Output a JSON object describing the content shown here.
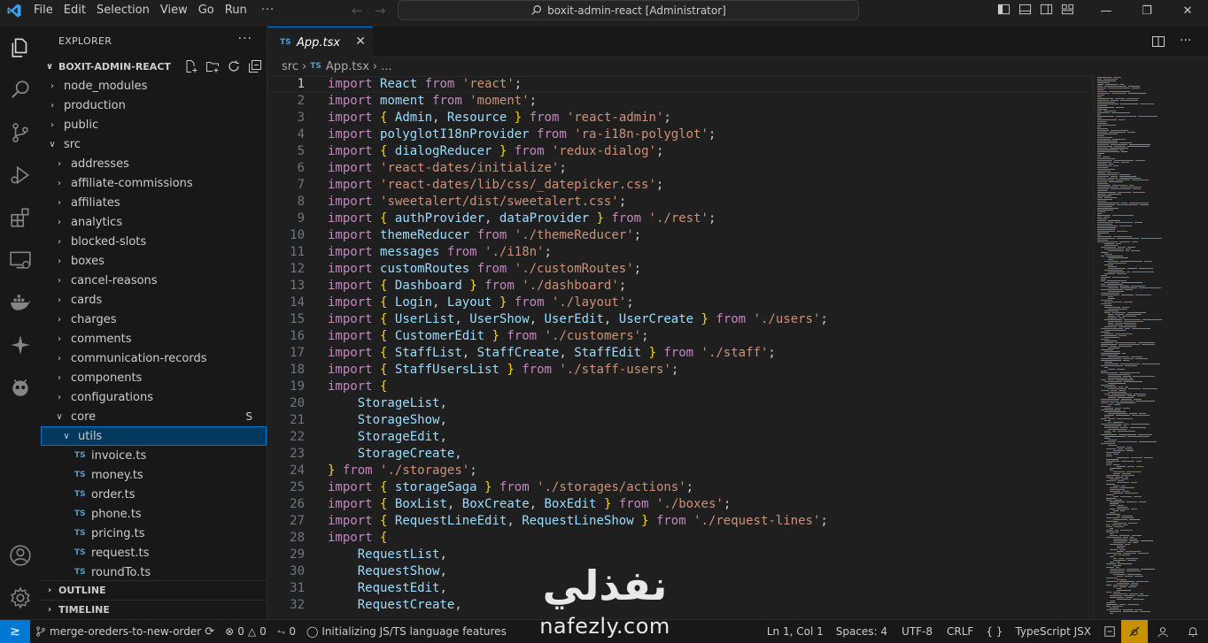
{
  "menubar": {
    "items": [
      "File",
      "Edit",
      "Selection",
      "View",
      "Go",
      "Run"
    ],
    "more": "···"
  },
  "command_center": {
    "title": "boxit-admin-react [Administrator]"
  },
  "sidebar": {
    "title": "EXPLORER",
    "more": "···",
    "project": "BOXIT-ADMIN-REACT",
    "tree": [
      {
        "label": "node_modules",
        "type": "folder",
        "expanded": false,
        "depth": 1
      },
      {
        "label": "production",
        "type": "folder",
        "expanded": false,
        "depth": 1
      },
      {
        "label": "public",
        "type": "folder",
        "expanded": false,
        "depth": 1
      },
      {
        "label": "src",
        "type": "folder",
        "expanded": true,
        "depth": 1
      },
      {
        "label": "addresses",
        "type": "folder",
        "expanded": false,
        "depth": 2
      },
      {
        "label": "affiliate-commissions",
        "type": "folder",
        "expanded": false,
        "depth": 2
      },
      {
        "label": "affiliates",
        "type": "folder",
        "expanded": false,
        "depth": 2
      },
      {
        "label": "analytics",
        "type": "folder",
        "expanded": false,
        "depth": 2
      },
      {
        "label": "blocked-slots",
        "type": "folder",
        "expanded": false,
        "depth": 2
      },
      {
        "label": "boxes",
        "type": "folder",
        "expanded": false,
        "depth": 2
      },
      {
        "label": "cancel-reasons",
        "type": "folder",
        "expanded": false,
        "depth": 2
      },
      {
        "label": "cards",
        "type": "folder",
        "expanded": false,
        "depth": 2
      },
      {
        "label": "charges",
        "type": "folder",
        "expanded": false,
        "depth": 2
      },
      {
        "label": "comments",
        "type": "folder",
        "expanded": false,
        "depth": 2
      },
      {
        "label": "communication-records",
        "type": "folder",
        "expanded": false,
        "depth": 2
      },
      {
        "label": "components",
        "type": "folder",
        "expanded": false,
        "depth": 2
      },
      {
        "label": "configurations",
        "type": "folder",
        "expanded": false,
        "depth": 2
      },
      {
        "label": "core",
        "type": "folder",
        "expanded": true,
        "depth": 2,
        "badge": "S"
      },
      {
        "label": "utils",
        "type": "folder",
        "expanded": true,
        "depth": 3,
        "selected": true
      },
      {
        "label": "invoice.ts",
        "type": "file",
        "depth": 4,
        "badge_icon": "TS"
      },
      {
        "label": "money.ts",
        "type": "file",
        "depth": 4,
        "badge_icon": "TS"
      },
      {
        "label": "order.ts",
        "type": "file",
        "depth": 4,
        "badge_icon": "TS"
      },
      {
        "label": "phone.ts",
        "type": "file",
        "depth": 4,
        "badge_icon": "TS"
      },
      {
        "label": "pricing.ts",
        "type": "file",
        "depth": 4,
        "badge_icon": "TS"
      },
      {
        "label": "request.ts",
        "type": "file",
        "depth": 4,
        "badge_icon": "TS"
      },
      {
        "label": "roundTo.ts",
        "type": "file",
        "depth": 4,
        "badge_icon": "TS"
      }
    ],
    "outline": "OUTLINE",
    "timeline": "TIMELINE"
  },
  "editor": {
    "tab": {
      "badge": "TS",
      "label": "App.tsx"
    },
    "breadcrumb": {
      "folder": "src",
      "badge": "TS",
      "file": "App.tsx",
      "more": "..."
    },
    "lines": [
      [
        [
          "k",
          "import"
        ],
        [
          "p",
          " "
        ],
        [
          "i",
          "React"
        ],
        [
          "p",
          " "
        ],
        [
          "k",
          "from"
        ],
        [
          "p",
          " "
        ],
        [
          "s",
          "'react'"
        ],
        [
          "p",
          ";"
        ]
      ],
      [
        [
          "k",
          "import"
        ],
        [
          "p",
          " "
        ],
        [
          "i",
          "moment"
        ],
        [
          "p",
          " "
        ],
        [
          "k",
          "from"
        ],
        [
          "p",
          " "
        ],
        [
          "s",
          "'moment'"
        ],
        [
          "p",
          ";"
        ]
      ],
      [
        [
          "k",
          "import"
        ],
        [
          "p",
          " "
        ],
        [
          "b",
          "{"
        ],
        [
          "p",
          " "
        ],
        [
          "i",
          "Admin"
        ],
        [
          "p",
          ", "
        ],
        [
          "i",
          "Resource"
        ],
        [
          "p",
          " "
        ],
        [
          "b",
          "}"
        ],
        [
          "p",
          " "
        ],
        [
          "k",
          "from"
        ],
        [
          "p",
          " "
        ],
        [
          "s",
          "'react-admin'"
        ],
        [
          "p",
          ";"
        ]
      ],
      [
        [
          "k",
          "import"
        ],
        [
          "p",
          " "
        ],
        [
          "i",
          "polyglotI18nProvider"
        ],
        [
          "p",
          " "
        ],
        [
          "k",
          "from"
        ],
        [
          "p",
          " "
        ],
        [
          "s",
          "'ra-i18n-polyglot'"
        ],
        [
          "p",
          ";"
        ]
      ],
      [
        [
          "k",
          "import"
        ],
        [
          "p",
          " "
        ],
        [
          "b",
          "{"
        ],
        [
          "p",
          " "
        ],
        [
          "i",
          "dialogReducer"
        ],
        [
          "p",
          " "
        ],
        [
          "b",
          "}"
        ],
        [
          "p",
          " "
        ],
        [
          "k",
          "from"
        ],
        [
          "p",
          " "
        ],
        [
          "s",
          "'redux-dialog'"
        ],
        [
          "p",
          ";"
        ]
      ],
      [
        [
          "k",
          "import"
        ],
        [
          "p",
          " "
        ],
        [
          "s",
          "'react-dates/initialize'"
        ],
        [
          "p",
          ";"
        ]
      ],
      [
        [
          "k",
          "import"
        ],
        [
          "p",
          " "
        ],
        [
          "s",
          "'react-dates/lib/css/_datepicker.css'"
        ],
        [
          "p",
          ";"
        ]
      ],
      [
        [
          "k",
          "import"
        ],
        [
          "p",
          " "
        ],
        [
          "s",
          "'sweetalert/dist/sweetalert.css'"
        ],
        [
          "p",
          ";"
        ]
      ],
      [
        [
          "k",
          "import"
        ],
        [
          "p",
          " "
        ],
        [
          "b",
          "{"
        ],
        [
          "p",
          " "
        ],
        [
          "i",
          "authProvider"
        ],
        [
          "p",
          ", "
        ],
        [
          "i",
          "dataProvider"
        ],
        [
          "p",
          " "
        ],
        [
          "b",
          "}"
        ],
        [
          "p",
          " "
        ],
        [
          "k",
          "from"
        ],
        [
          "p",
          " "
        ],
        [
          "s",
          "'./rest'"
        ],
        [
          "p",
          ";"
        ]
      ],
      [
        [
          "k",
          "import"
        ],
        [
          "p",
          " "
        ],
        [
          "i",
          "themeReducer"
        ],
        [
          "p",
          " "
        ],
        [
          "k",
          "from"
        ],
        [
          "p",
          " "
        ],
        [
          "s",
          "'./themeReducer'"
        ],
        [
          "p",
          ";"
        ]
      ],
      [
        [
          "k",
          "import"
        ],
        [
          "p",
          " "
        ],
        [
          "i",
          "messages"
        ],
        [
          "p",
          " "
        ],
        [
          "k",
          "from"
        ],
        [
          "p",
          " "
        ],
        [
          "s",
          "'./i18n'"
        ],
        [
          "p",
          ";"
        ]
      ],
      [
        [
          "k",
          "import"
        ],
        [
          "p",
          " "
        ],
        [
          "i",
          "customRoutes"
        ],
        [
          "p",
          " "
        ],
        [
          "k",
          "from"
        ],
        [
          "p",
          " "
        ],
        [
          "s",
          "'./customRoutes'"
        ],
        [
          "p",
          ";"
        ]
      ],
      [
        [
          "k",
          "import"
        ],
        [
          "p",
          " "
        ],
        [
          "b",
          "{"
        ],
        [
          "p",
          " "
        ],
        [
          "i",
          "Dashboard"
        ],
        [
          "p",
          " "
        ],
        [
          "b",
          "}"
        ],
        [
          "p",
          " "
        ],
        [
          "k",
          "from"
        ],
        [
          "p",
          " "
        ],
        [
          "s",
          "'./dashboard'"
        ],
        [
          "p",
          ";"
        ]
      ],
      [
        [
          "k",
          "import"
        ],
        [
          "p",
          " "
        ],
        [
          "b",
          "{"
        ],
        [
          "p",
          " "
        ],
        [
          "i",
          "Login"
        ],
        [
          "p",
          ", "
        ],
        [
          "i",
          "Layout"
        ],
        [
          "p",
          " "
        ],
        [
          "b",
          "}"
        ],
        [
          "p",
          " "
        ],
        [
          "k",
          "from"
        ],
        [
          "p",
          " "
        ],
        [
          "s",
          "'./layout'"
        ],
        [
          "p",
          ";"
        ]
      ],
      [
        [
          "k",
          "import"
        ],
        [
          "p",
          " "
        ],
        [
          "b",
          "{"
        ],
        [
          "p",
          " "
        ],
        [
          "i",
          "UserList"
        ],
        [
          "p",
          ", "
        ],
        [
          "i",
          "UserShow"
        ],
        [
          "p",
          ", "
        ],
        [
          "i",
          "UserEdit"
        ],
        [
          "p",
          ", "
        ],
        [
          "i",
          "UserCreate"
        ],
        [
          "p",
          " "
        ],
        [
          "b",
          "}"
        ],
        [
          "p",
          " "
        ],
        [
          "k",
          "from"
        ],
        [
          "p",
          " "
        ],
        [
          "s",
          "'./users'"
        ],
        [
          "p",
          ";"
        ]
      ],
      [
        [
          "k",
          "import"
        ],
        [
          "p",
          " "
        ],
        [
          "b",
          "{"
        ],
        [
          "p",
          " "
        ],
        [
          "i",
          "CustomerEdit"
        ],
        [
          "p",
          " "
        ],
        [
          "b",
          "}"
        ],
        [
          "p",
          " "
        ],
        [
          "k",
          "from"
        ],
        [
          "p",
          " "
        ],
        [
          "s",
          "'./customers'"
        ],
        [
          "p",
          ";"
        ]
      ],
      [
        [
          "k",
          "import"
        ],
        [
          "p",
          " "
        ],
        [
          "b",
          "{"
        ],
        [
          "p",
          " "
        ],
        [
          "i",
          "StaffList"
        ],
        [
          "p",
          ", "
        ],
        [
          "i",
          "StaffCreate"
        ],
        [
          "p",
          ", "
        ],
        [
          "i",
          "StaffEdit"
        ],
        [
          "p",
          " "
        ],
        [
          "b",
          "}"
        ],
        [
          "p",
          " "
        ],
        [
          "k",
          "from"
        ],
        [
          "p",
          " "
        ],
        [
          "s",
          "'./staff'"
        ],
        [
          "p",
          ";"
        ]
      ],
      [
        [
          "k",
          "import"
        ],
        [
          "p",
          " "
        ],
        [
          "b",
          "{"
        ],
        [
          "p",
          " "
        ],
        [
          "i",
          "StaffUsersList"
        ],
        [
          "p",
          " "
        ],
        [
          "b",
          "}"
        ],
        [
          "p",
          " "
        ],
        [
          "k",
          "from"
        ],
        [
          "p",
          " "
        ],
        [
          "s",
          "'./staff-users'"
        ],
        [
          "p",
          ";"
        ]
      ],
      [
        [
          "k",
          "import"
        ],
        [
          "p",
          " "
        ],
        [
          "b",
          "{"
        ]
      ],
      [
        [
          "p",
          "    "
        ],
        [
          "i",
          "StorageList"
        ],
        [
          "p",
          ","
        ]
      ],
      [
        [
          "p",
          "    "
        ],
        [
          "i",
          "StorageShow"
        ],
        [
          "p",
          ","
        ]
      ],
      [
        [
          "p",
          "    "
        ],
        [
          "i",
          "StorageEdit"
        ],
        [
          "p",
          ","
        ]
      ],
      [
        [
          "p",
          "    "
        ],
        [
          "i",
          "StorageCreate"
        ],
        [
          "p",
          ","
        ]
      ],
      [
        [
          "b",
          "}"
        ],
        [
          "p",
          " "
        ],
        [
          "k",
          "from"
        ],
        [
          "p",
          " "
        ],
        [
          "s",
          "'./storages'"
        ],
        [
          "p",
          ";"
        ]
      ],
      [
        [
          "k",
          "import"
        ],
        [
          "p",
          " "
        ],
        [
          "b",
          "{"
        ],
        [
          "p",
          " "
        ],
        [
          "i",
          "storageSaga"
        ],
        [
          "p",
          " "
        ],
        [
          "b",
          "}"
        ],
        [
          "p",
          " "
        ],
        [
          "k",
          "from"
        ],
        [
          "p",
          " "
        ],
        [
          "s",
          "'./storages/actions'"
        ],
        [
          "p",
          ";"
        ]
      ],
      [
        [
          "k",
          "import"
        ],
        [
          "p",
          " "
        ],
        [
          "b",
          "{"
        ],
        [
          "p",
          " "
        ],
        [
          "i",
          "BoxList"
        ],
        [
          "p",
          ", "
        ],
        [
          "i",
          "BoxCreate"
        ],
        [
          "p",
          ", "
        ],
        [
          "i",
          "BoxEdit"
        ],
        [
          "p",
          " "
        ],
        [
          "b",
          "}"
        ],
        [
          "p",
          " "
        ],
        [
          "k",
          "from"
        ],
        [
          "p",
          " "
        ],
        [
          "s",
          "'./boxes'"
        ],
        [
          "p",
          ";"
        ]
      ],
      [
        [
          "k",
          "import"
        ],
        [
          "p",
          " "
        ],
        [
          "b",
          "{"
        ],
        [
          "p",
          " "
        ],
        [
          "i",
          "RequestLineEdit"
        ],
        [
          "p",
          ", "
        ],
        [
          "i",
          "RequestLineShow"
        ],
        [
          "p",
          " "
        ],
        [
          "b",
          "}"
        ],
        [
          "p",
          " "
        ],
        [
          "k",
          "from"
        ],
        [
          "p",
          " "
        ],
        [
          "s",
          "'./request-lines'"
        ],
        [
          "p",
          ";"
        ]
      ],
      [
        [
          "k",
          "import"
        ],
        [
          "p",
          " "
        ],
        [
          "b",
          "{"
        ]
      ],
      [
        [
          "p",
          "    "
        ],
        [
          "i",
          "RequestList"
        ],
        [
          "p",
          ","
        ]
      ],
      [
        [
          "p",
          "    "
        ],
        [
          "i",
          "RequestShow"
        ],
        [
          "p",
          ","
        ]
      ],
      [
        [
          "p",
          "    "
        ],
        [
          "i",
          "RequestEdit"
        ],
        [
          "p",
          ","
        ]
      ],
      [
        [
          "p",
          "    "
        ],
        [
          "i",
          "RequestCreate"
        ],
        [
          "p",
          ","
        ]
      ]
    ]
  },
  "statusbar": {
    "branch": "merge-oreders-to-new-order",
    "errors": "0",
    "warnings": "0",
    "ports": "0",
    "task": "Initializing JS/TS language features",
    "position": "Ln 1, Col 1",
    "spaces": "Spaces: 4",
    "encoding": "UTF-8",
    "eol": "CRLF",
    "braces": "{ }",
    "language": "TypeScript JSX"
  },
  "watermark": {
    "arabic": "نفذلي",
    "latin": "nafezly.com"
  },
  "colors": {
    "keyword": "#c586c0",
    "string": "#ce9178",
    "identifier": "#9cdcfe",
    "bracket": "#ffd700",
    "accent": "#0078d4",
    "ts_badge": "#4d9cd6"
  },
  "icons": {
    "activity": [
      "explorer-icon",
      "search-icon",
      "source-control-icon",
      "run-debug-icon",
      "extensions-icon",
      "remote-explorer-icon",
      "docker-icon",
      "copilot-icon",
      "platformio-icon",
      "accounts-icon",
      "settings-gear-icon"
    ]
  }
}
